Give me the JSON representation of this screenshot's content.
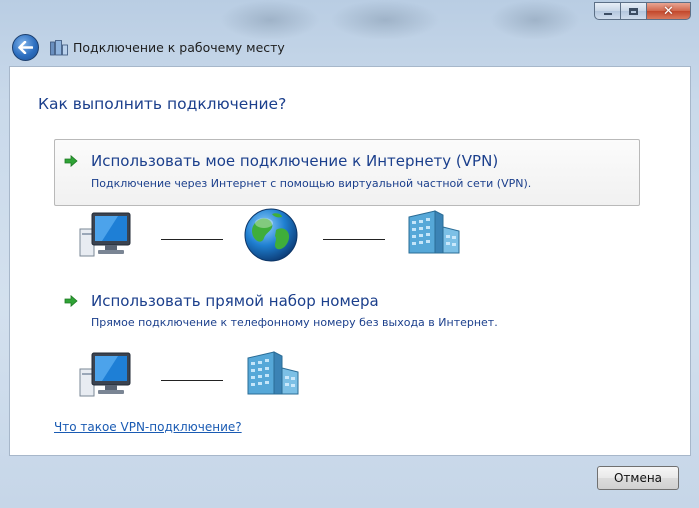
{
  "window": {
    "title": "Подключение к рабочему месту",
    "caption_buttons": [
      "minimize",
      "maximize",
      "close"
    ]
  },
  "heading": "Как выполнить подключение?",
  "options": [
    {
      "title": "Использовать мое подключение к Интернету (VPN)",
      "description": "Подключение через Интернет с помощью виртуальной частной сети (VPN).",
      "icon": "green-arrow-icon",
      "diagram": [
        "computer-icon",
        "globe-icon",
        "office-building-icon"
      ]
    },
    {
      "title": "Использовать прямой набор номера",
      "description": "Прямое подключение к телефонному номеру без выхода в Интернет.",
      "icon": "green-arrow-icon",
      "diagram": [
        "computer-icon",
        "office-building-icon"
      ]
    }
  ],
  "help_link": "Что такое VPN-подключение?",
  "footer": {
    "cancel_label": "Отмена"
  },
  "colors": {
    "heading_text": "#1b3f8c",
    "link": "#1a5bb3",
    "close_button": "#c2462a",
    "accent_arrow": "#2fa336"
  }
}
